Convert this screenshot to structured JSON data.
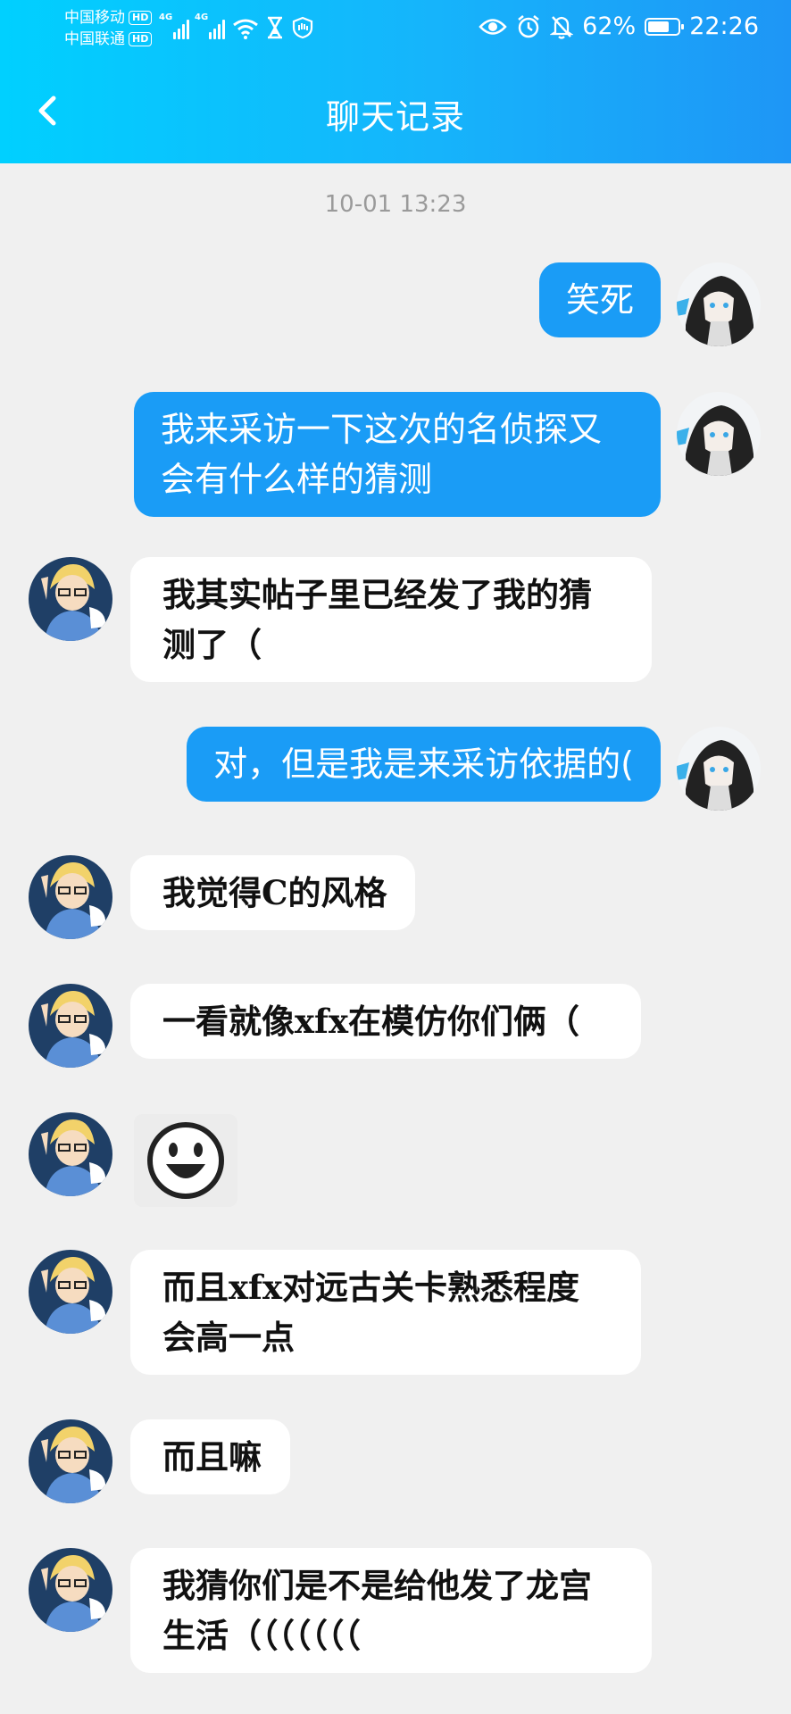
{
  "status_bar": {
    "carrier1": "中国移动",
    "carrier2": "中国联通",
    "hd_label": "HD",
    "network1": "4G",
    "network2": "4G",
    "battery_percent": "62%",
    "battery_level": 0.62,
    "time": "22:26",
    "icons": [
      "wifi-icon",
      "hourglass-icon",
      "shield-hand-icon",
      "eye-icon",
      "alarm-icon",
      "bell-off-icon"
    ]
  },
  "header": {
    "title": "聊天记录",
    "back_icon": "chevron-left-icon",
    "gradient": [
      "#00d0ff",
      "#1e96f6"
    ]
  },
  "chat": {
    "timestamp": "10-01 13:23",
    "colors": {
      "mine_bubble": "#1a9cf6",
      "theirs_bubble": "#ffffff",
      "background": "#f0f0f0"
    },
    "messages": [
      {
        "sender": "me",
        "text": "笑死"
      },
      {
        "sender": "me",
        "text": "我来采访一下这次的名侦探又\n会有什么样的猜测"
      },
      {
        "sender": "other",
        "text": "我其实帖子里已经发了我的猜\n测了（"
      },
      {
        "sender": "me",
        "text": "对，但是我是来采访依据的("
      },
      {
        "sender": "other",
        "text": "我觉得C的风格"
      },
      {
        "sender": "other",
        "text": "一看就像xfx在模仿你们俩（"
      },
      {
        "sender": "other",
        "type": "sticker",
        "sticker": "smiley-face-sticker"
      },
      {
        "sender": "other",
        "text": "而且xfx对远古关卡熟悉程度\n会高一点"
      },
      {
        "sender": "other",
        "text": "而且嘛"
      },
      {
        "sender": "other",
        "text": "我猜你们是不是给他发了龙宫\n生活（（（（（（（"
      }
    ]
  }
}
